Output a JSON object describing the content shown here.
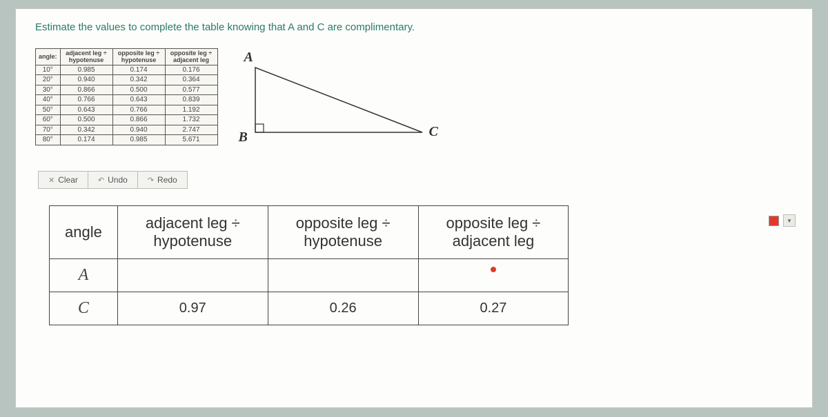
{
  "prompt": "Estimate the values to complete the table knowing that A and C are complimentary.",
  "ref_headers": {
    "angle": "angle:",
    "c1": "adjacent leg ÷ hypotenuse",
    "c2": "opposite leg ÷ hypotenuse",
    "c3": "opposite leg ÷ adjacent leg"
  },
  "ref_rows": [
    {
      "a": "10°",
      "c1": "0.985",
      "c2": "0.174",
      "c3": "0.176"
    },
    {
      "a": "20°",
      "c1": "0.940",
      "c2": "0.342",
      "c3": "0.364"
    },
    {
      "a": "30°",
      "c1": "0.866",
      "c2": "0.500",
      "c3": "0.577"
    },
    {
      "a": "40°",
      "c1": "0.766",
      "c2": "0.643",
      "c3": "0.839"
    },
    {
      "a": "50°",
      "c1": "0.643",
      "c2": "0.766",
      "c3": "1.192"
    },
    {
      "a": "60°",
      "c1": "0.500",
      "c2": "0.866",
      "c3": "1.732"
    },
    {
      "a": "70°",
      "c1": "0.342",
      "c2": "0.940",
      "c3": "2.747"
    },
    {
      "a": "80°",
      "c1": "0.174",
      "c2": "0.985",
      "c3": "5.671"
    }
  ],
  "triangle": {
    "A": "A",
    "B": "B",
    "C": "C"
  },
  "controls": {
    "clear": "Clear",
    "undo": "Undo",
    "redo": "Redo"
  },
  "answer": {
    "headers": {
      "angle": "angle",
      "c1a": "adjacent leg ÷",
      "c1b": "hypotenuse",
      "c2a": "opposite leg ÷",
      "c2b": "hypotenuse",
      "c3a": "opposite leg ÷",
      "c3b": "adjacent leg"
    },
    "rows": {
      "A": {
        "label": "A",
        "c1": "",
        "c2": "",
        "c3": ""
      },
      "C": {
        "label": "C",
        "c1": "0.97",
        "c2": "0.26",
        "c3": "0.27"
      }
    }
  }
}
